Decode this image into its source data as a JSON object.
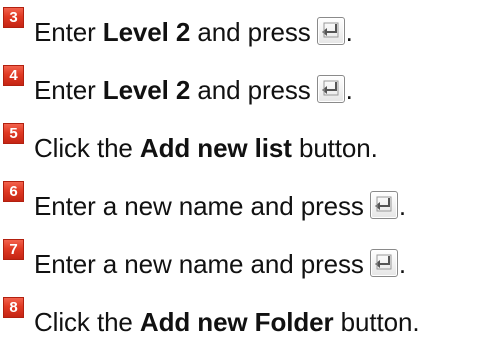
{
  "steps": [
    {
      "number": "3",
      "pre": "Enter ",
      "bold": "Level 2",
      "post": " and press",
      "end": ".",
      "icon": "enter-key-icon"
    },
    {
      "number": "4",
      "pre": "Enter ",
      "bold": "Level 2",
      "post": " and press",
      "end": ".",
      "icon": "enter-key-icon"
    },
    {
      "number": "5",
      "pre": "Click the ",
      "bold": "Add new list",
      "post": " button.",
      "end": ""
    },
    {
      "number": "6",
      "pre": "Enter a new name and press",
      "bold": "",
      "post": "",
      "end": ".",
      "icon": "enter-key-icon"
    },
    {
      "number": "7",
      "pre": "Enter a new name and press",
      "bold": "",
      "post": "",
      "end": ".",
      "icon": "enter-key-icon"
    },
    {
      "number": "8",
      "pre": "Click the ",
      "bold": "Add new Folder",
      "post": " button.",
      "end": ""
    }
  ],
  "colors": {
    "badge": "#e03a24",
    "text": "#111111"
  }
}
